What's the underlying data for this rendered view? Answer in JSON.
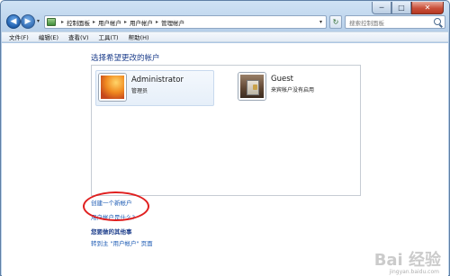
{
  "window": {
    "controls": {
      "minimize": "─",
      "maximize": "□",
      "close": "✕"
    }
  },
  "nav": {
    "back_icon": "◀",
    "forward_icon": "▶",
    "dropdown_icon": "▾",
    "breadcrumbs": [
      "控制面板",
      "用户帐户",
      "用户帐户",
      "管理帐户"
    ],
    "crumb_separator": "▸",
    "refresh_icon": "↻",
    "search_placeholder": "搜索控制面板"
  },
  "menubar": {
    "items": [
      "文件(F)",
      "编辑(E)",
      "查看(V)",
      "工具(T)",
      "帮助(H)"
    ]
  },
  "main": {
    "title": "选择希望更改的帐户",
    "accounts": [
      {
        "name": "Administrator",
        "role": "管理员",
        "avatar": "flower-avatar-icon"
      },
      {
        "name": "Guest",
        "role": "来宾帐户没有启用",
        "avatar": "suitcase-avatar-icon"
      }
    ],
    "links": [
      "创建一个新帐户",
      "用户帐户是什么?"
    ],
    "other_title": "您要做的其他事",
    "goto_link": "转到主 \"用户帐户\" 页面"
  },
  "watermark": {
    "text": "Bai 经验",
    "sub": "jingyan.baidu.com"
  },
  "colors": {
    "accent": "#1e3f8c",
    "link": "#1d5bb4",
    "highlight": "#e02020"
  }
}
